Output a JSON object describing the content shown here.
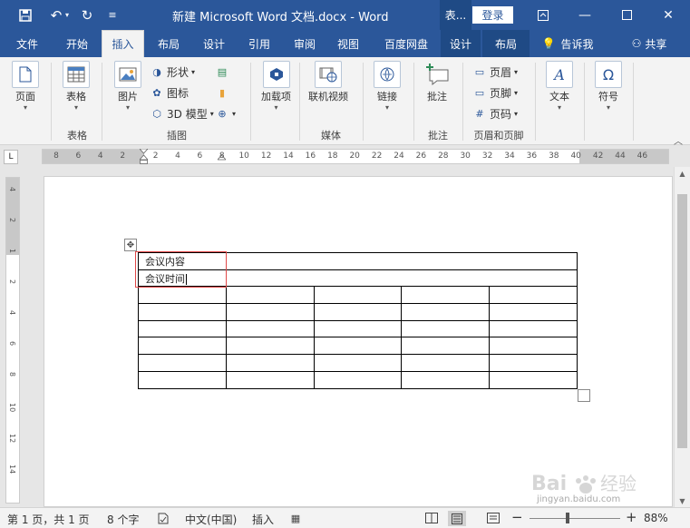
{
  "titlebar": {
    "title": "新建 Microsoft Word 文档.docx  -  Word",
    "context_title": "表...",
    "login": "登录",
    "quick_access": {
      "save_icon": "save-icon",
      "undo_icon": "undo-icon",
      "redo_icon": "redo-icon",
      "customize_icon": "customize-icon"
    }
  },
  "tabs": [
    "文件",
    "开始",
    "插入",
    "布局",
    "设计",
    "引用",
    "审阅",
    "视图",
    "百度网盘",
    "设计",
    "布局"
  ],
  "tell_me": "告诉我",
  "share": "共享",
  "ribbon": {
    "pages": {
      "label": "页面",
      "group": ""
    },
    "tables": {
      "label": "表格",
      "group": "表格"
    },
    "illustrations": {
      "group": "插图",
      "picture": "图片",
      "shapes": "形状",
      "icons": "图标",
      "model3d": "3D 模型"
    },
    "addins": {
      "label": "加载项"
    },
    "media": {
      "label": "联机视频",
      "group": "媒体"
    },
    "links": {
      "label": "链接"
    },
    "comments": {
      "label": "批注",
      "group": "批注"
    },
    "header_footer": {
      "header": "页眉",
      "footer": "页脚",
      "page_number": "页码",
      "group": "页眉和页脚"
    },
    "text": {
      "label": "文本"
    },
    "symbols": {
      "label": "符号"
    }
  },
  "ruler": {
    "numbers": [
      "8",
      "6",
      "4",
      "2",
      "2",
      "4",
      "6",
      "8",
      "10",
      "12",
      "14",
      "16",
      "18",
      "20",
      "22",
      "24",
      "26",
      "28",
      "30",
      "32",
      "34",
      "36",
      "38",
      "40",
      "42",
      "44",
      "46"
    ],
    "vnumbers": [
      "4",
      "2",
      "1",
      "2",
      "4",
      "6",
      "8",
      "10",
      "12",
      "14"
    ]
  },
  "document": {
    "rows": [
      [
        "会议内容",
        "",
        "",
        "",
        ""
      ],
      [
        "会议时间",
        "",
        "",
        "",
        ""
      ],
      [
        "",
        "",
        "",
        "",
        ""
      ],
      [
        "",
        "",
        "",
        "",
        ""
      ],
      [
        "",
        "",
        "",
        "",
        ""
      ],
      [
        "",
        "",
        "",
        "",
        ""
      ],
      [
        "",
        "",
        "",
        "",
        ""
      ],
      [
        "",
        "",
        "",
        "",
        ""
      ]
    ]
  },
  "statusbar": {
    "page": "第 1 页，共 1 页",
    "words": "8 个字",
    "language": "中文(中国)",
    "mode": "插入",
    "zoom": "88%"
  },
  "watermark": {
    "brand": "Bai经验",
    "url": "jingyan.baidu.com"
  },
  "colors": {
    "accent": "#2b579a",
    "context_tab": "#1f4a85",
    "selection": "#e04848"
  }
}
